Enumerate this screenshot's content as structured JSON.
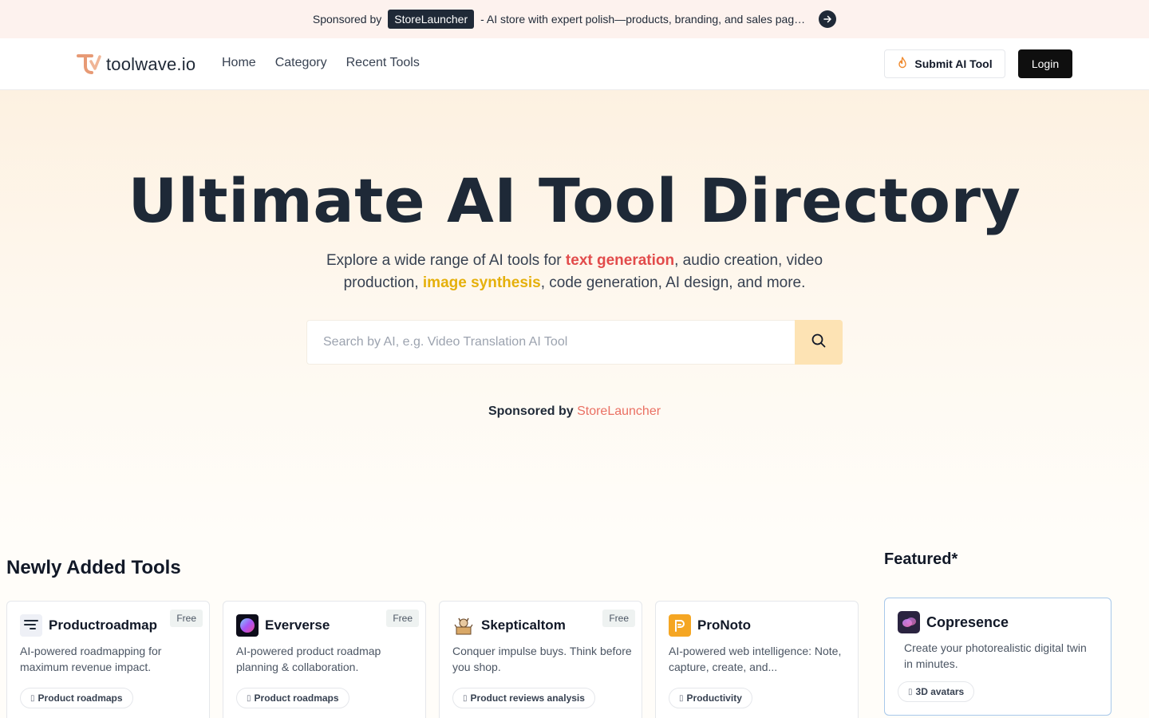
{
  "sponsor_bar": {
    "label": "Sponsored by",
    "brand": "StoreLauncher",
    "text": "- AI store with expert polish—products, branding, and sales pages, ready to launch",
    "arrow_icon": "arrow-right-icon"
  },
  "header": {
    "logo_text": "toolwave.io",
    "nav": [
      {
        "label": "Home"
      },
      {
        "label": "Category"
      },
      {
        "label": "Recent Tools"
      }
    ],
    "submit_label": "Submit AI Tool",
    "submit_icon": "flame-icon",
    "login_label": "Login"
  },
  "hero": {
    "title": "Ultimate AI Tool Directory",
    "sub_part1": "Explore a wide range of AI tools for ",
    "sub_hl1": "text generation",
    "sub_part2": ", audio creation, video production, ",
    "sub_hl2": "image synthesis",
    "sub_part3": ", code generation, AI design, and more.",
    "search_placeholder": "Search by AI, e.g. Video Translation AI Tool",
    "sponsor_label": "Sponsored by",
    "sponsor_brand": "StoreLauncher"
  },
  "colors": {
    "accent_red": "#e24b4b",
    "accent_yellow": "#e5b00b",
    "search_button": "#fde3b4"
  },
  "newly_added": {
    "title": "Newly Added Tools",
    "cards": [
      {
        "name": "Productroadmap",
        "badge": "Free",
        "desc": "AI-powered roadmapping for maximum revenue impact.",
        "tag": "Product roadmaps",
        "icon": "roadmap-icon"
      },
      {
        "name": "Eververse",
        "badge": "Free",
        "desc": "AI-powered product roadmap planning & collaboration.",
        "tag": "Product roadmaps",
        "icon": "eververse-icon"
      },
      {
        "name": "Skepticaltom",
        "badge": "Free",
        "desc": "Conquer impulse buys. Think before you shop.",
        "tag": "Product reviews analysis",
        "icon": "cat-box-icon"
      },
      {
        "name": "ProNoto",
        "badge": "",
        "desc": "AI-powered web intelligence: Note, capture, create, and...",
        "tag": "Productivity",
        "icon": "pronoto-icon"
      }
    ]
  },
  "featured": {
    "title": "Featured*",
    "card": {
      "name": "Copresence",
      "desc": "Create your photorealistic digital twin in minutes.",
      "tag": "3D avatars",
      "icon": "copresence-icon"
    }
  }
}
